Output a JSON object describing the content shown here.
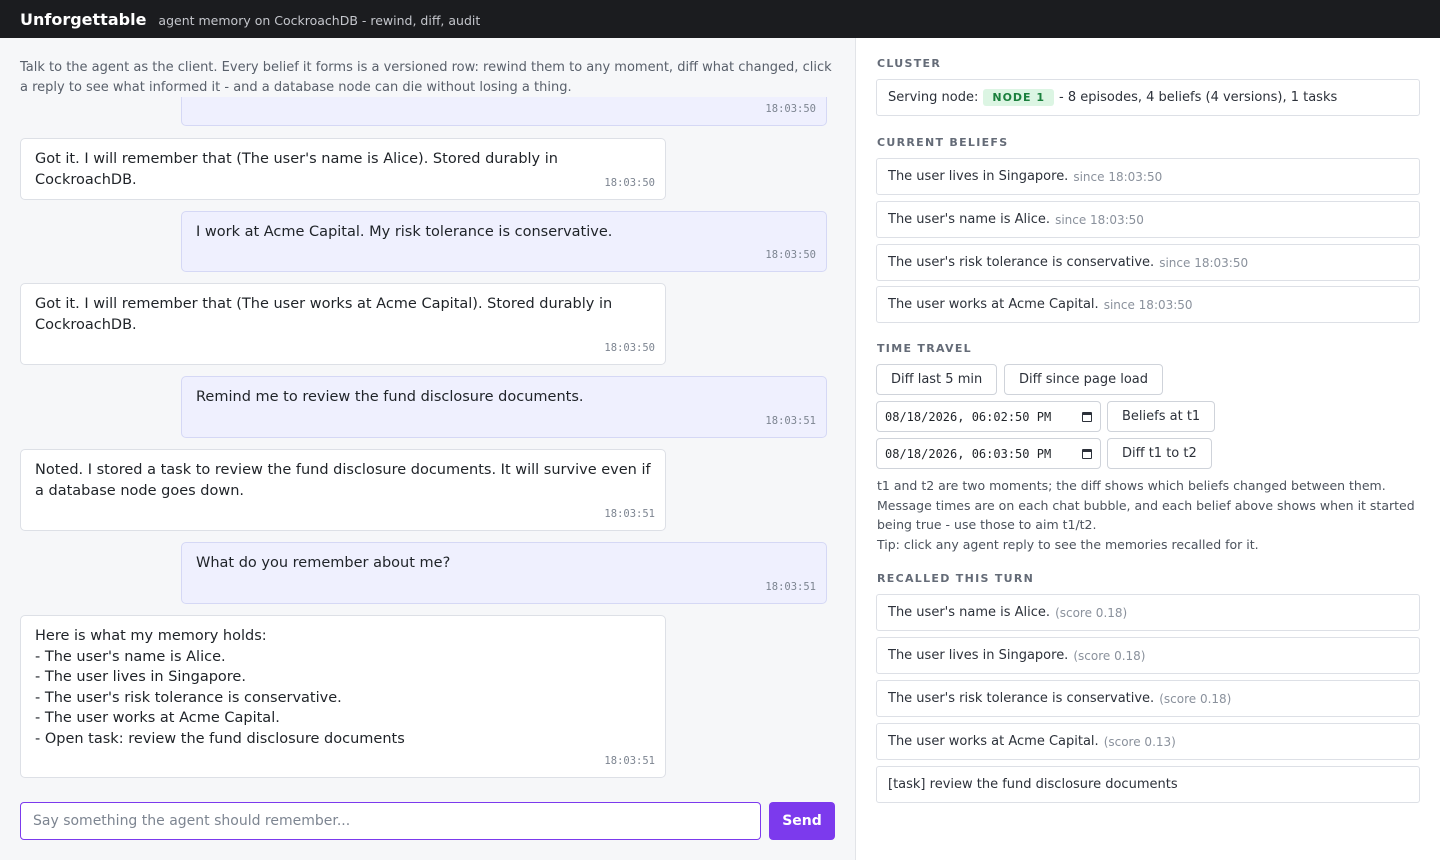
{
  "header": {
    "title": "Unforgettable",
    "subtitle": "agent memory on CockroachDB - rewind, diff, audit"
  },
  "intro": "Talk to the agent as the client. Every belief it forms is a versioned row: rewind them to any moment, diff what changed, click a reply to see what informed it - and a database node can die without losing a thing.",
  "messages": [
    {
      "role": "user",
      "text": "",
      "time": "18:03:50"
    },
    {
      "role": "agent",
      "text": "Got it. I will remember that (The user's name is Alice). Stored durably in CockroachDB.",
      "time": "18:03:50"
    },
    {
      "role": "user",
      "text": "I work at Acme Capital. My risk tolerance is conservative.",
      "time": "18:03:50"
    },
    {
      "role": "agent",
      "text": "Got it. I will remember that (The user works at Acme Capital). Stored durably in CockroachDB.",
      "time": "18:03:50"
    },
    {
      "role": "user",
      "text": "Remind me to review the fund disclosure documents.",
      "time": "18:03:51"
    },
    {
      "role": "agent",
      "text": "Noted. I stored a task to review the fund disclosure documents. It will survive even if a database node goes down.",
      "time": "18:03:51"
    },
    {
      "role": "user",
      "text": "What do you remember about me?",
      "time": "18:03:51"
    },
    {
      "role": "agent",
      "text": "Here is what my memory holds:\n- The user's name is Alice.\n- The user lives in Singapore.\n- The user's risk tolerance is conservative.\n- The user works at Acme Capital.\n- Open task: review the fund disclosure documents",
      "time": "18:03:51"
    }
  ],
  "composer": {
    "placeholder": "Say something the agent should remember...",
    "send_label": "Send"
  },
  "cluster": {
    "heading": "CLUSTER",
    "serving_label": "Serving node:",
    "node": "NODE 1",
    "stats": "- 8 episodes, 4 beliefs (4 versions), 1 tasks"
  },
  "beliefs": {
    "heading": "CURRENT BELIEFS",
    "items": [
      {
        "text": "The user lives in Singapore.",
        "since": "since 18:03:50"
      },
      {
        "text": "The user's name is Alice.",
        "since": "since 18:03:50"
      },
      {
        "text": "The user's risk tolerance is conservative.",
        "since": "since 18:03:50"
      },
      {
        "text": "The user works at Acme Capital.",
        "since": "since 18:03:50"
      }
    ]
  },
  "time_travel": {
    "heading": "TIME TRAVEL",
    "diff_last_label": "Diff last 5 min",
    "diff_since_label": "Diff since page load",
    "t1_value": "08/18/2026, 06:02:50 PM",
    "t2_value": "08/18/2026, 06:03:50 PM",
    "beliefs_at_label": "Beliefs at t1",
    "diff_t1_t2_label": "Diff t1 to t2",
    "help": "t1 and t2 are two moments; the diff shows which beliefs changed between them. Message times are on each chat bubble, and each belief above shows when it started being true - use those to aim t1/t2.",
    "tip": "Tip: click any agent reply to see the memories recalled for it."
  },
  "recalled": {
    "heading": "RECALLED THIS TURN",
    "items": [
      {
        "text": "The user's name is Alice.",
        "score": "(score 0.18)"
      },
      {
        "text": "The user lives in Singapore.",
        "score": "(score 0.18)"
      },
      {
        "text": "The user's risk tolerance is conservative.",
        "score": "(score 0.18)"
      },
      {
        "text": "The user works at Acme Capital.",
        "score": "(score 0.13)"
      },
      {
        "text": "[task] review the fund disclosure documents",
        "score": ""
      }
    ]
  }
}
